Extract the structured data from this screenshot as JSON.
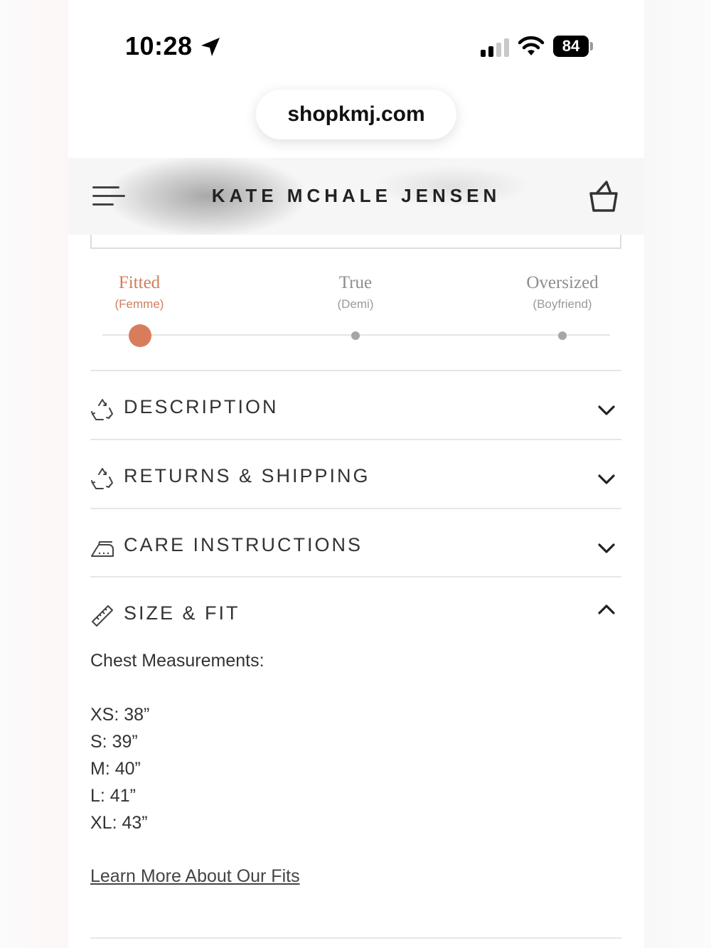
{
  "status_bar": {
    "time": "10:28",
    "battery": "84"
  },
  "browser": {
    "url": "shopkmj.com"
  },
  "header": {
    "brand": "KATE MCHALE JENSEN"
  },
  "fit_scale": {
    "options": [
      {
        "title": "Fitted",
        "sub": "(Femme)"
      },
      {
        "title": "True",
        "sub": "(Demi)"
      },
      {
        "title": "Oversized",
        "sub": "(Boyfriend)"
      }
    ],
    "selected": "Fitted",
    "active_color": "#d87d5c"
  },
  "accordion": [
    {
      "label": "DESCRIPTION",
      "icon": "recycle-icon",
      "expanded": false
    },
    {
      "label": "RETURNS & SHIPPING",
      "icon": "recycle-icon",
      "expanded": false
    },
    {
      "label": "CARE INSTRUCTIONS",
      "icon": "iron-icon",
      "expanded": false
    },
    {
      "label": "SIZE & FIT",
      "icon": "ruler-icon",
      "expanded": true
    }
  ],
  "size_fit": {
    "heading": "Chest Measurements:",
    "sizes": [
      "XS: 38”",
      "S: 39”",
      "M: 40”",
      "L: 41”",
      "XL: 43”"
    ],
    "learn_more": "Learn More About Our Fits"
  }
}
